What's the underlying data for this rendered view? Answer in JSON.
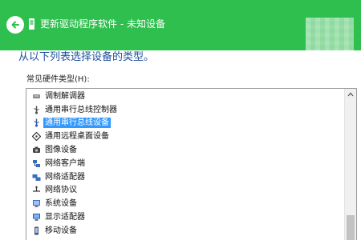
{
  "window": {
    "title": "更新驱动程序软件 - 未知设备",
    "accent_color": "#2fbf4e"
  },
  "heading": "从以下列表选择设备的类型。",
  "list_label": "常见硬件类型(H):",
  "device_types": [
    {
      "label": "调制解调器",
      "icon": "modem-icon",
      "selected": false
    },
    {
      "label": "通用串行总线控制器",
      "icon": "usb-controller-icon",
      "selected": false
    },
    {
      "label": "通用串行总线设备",
      "icon": "usb-device-icon",
      "selected": true
    },
    {
      "label": "通用远程桌面设备",
      "icon": "remote-desktop-icon",
      "selected": false
    },
    {
      "label": "图像设备",
      "icon": "imaging-device-icon",
      "selected": false
    },
    {
      "label": "网络客户端",
      "icon": "network-client-icon",
      "selected": false
    },
    {
      "label": "网络适配器",
      "icon": "network-adapter-icon",
      "selected": false
    },
    {
      "label": "网络协议",
      "icon": "network-protocol-icon",
      "selected": false
    },
    {
      "label": "系统设备",
      "icon": "system-device-icon",
      "selected": false
    },
    {
      "label": "显示适配器",
      "icon": "display-adapter-icon",
      "selected": false
    },
    {
      "label": "移动设备",
      "icon": "mobile-device-icon",
      "selected": false
    }
  ],
  "selection_color": "#3399ff"
}
